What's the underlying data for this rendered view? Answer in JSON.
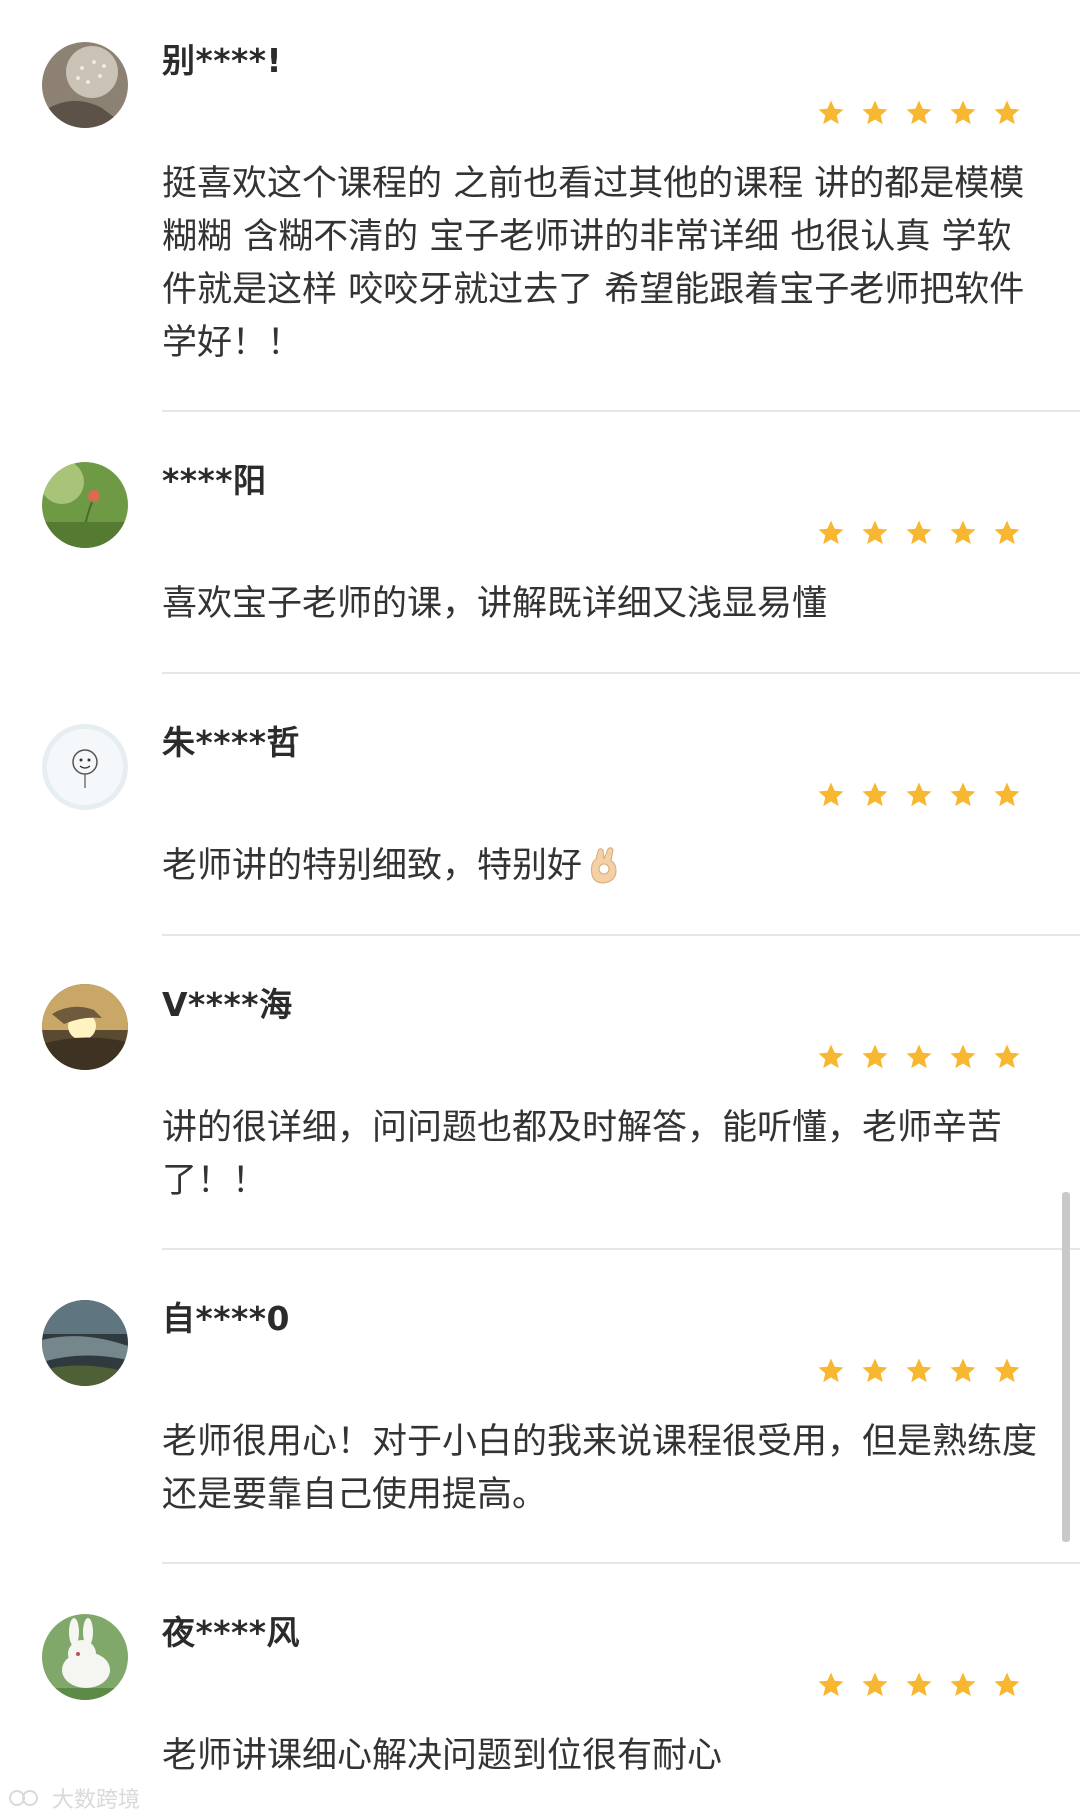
{
  "reviews": [
    {
      "username": "别****!",
      "rating": 5,
      "comment": "挺喜欢这个课程的 之前也看过其他的课程 讲的都是模模糊糊 含糊不清的 宝子老师讲的非常详细 也很认真 学软件就是这样 咬咬牙就过去了 希望能跟着宝子老师把软件学好！！"
    },
    {
      "username": "****阳",
      "rating": 5,
      "comment": "喜欢宝子老师的课，讲解既详细又浅显易懂"
    },
    {
      "username": "朱****哲",
      "rating": 5,
      "comment": "老师讲的特别细致，特别好"
    },
    {
      "username": "V****海",
      "rating": 5,
      "comment": "讲的很详细，问问题也都及时解答，能听懂，老师辛苦了！！"
    },
    {
      "username": "自****0",
      "rating": 5,
      "comment": "老师很用心！对于小白的我来说课程很受用，但是熟练度还是要靠自己使用提高。"
    },
    {
      "username": "夜****风",
      "rating": 5,
      "comment": "老师讲课细心解决问题到位很有耐心"
    }
  ],
  "icons": {
    "star": "star-icon",
    "emoji": "ok-hand-icon"
  },
  "colors": {
    "star": "#f7b731",
    "divider": "#e7e7e7",
    "text": "#333333"
  },
  "watermark": "大数跨境"
}
